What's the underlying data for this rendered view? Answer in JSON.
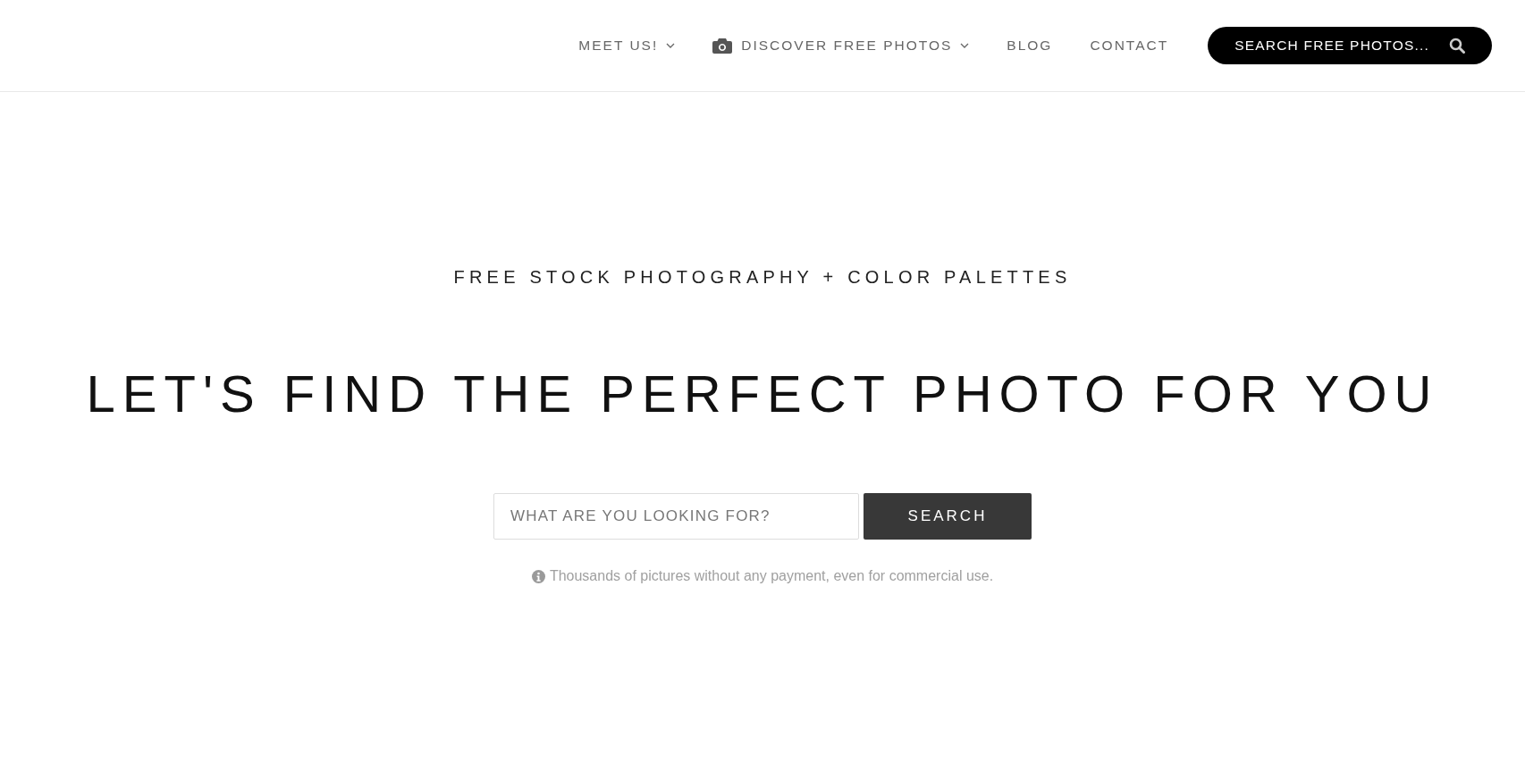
{
  "nav": [
    {
      "label": "MEET US!",
      "dropdown": true
    },
    {
      "label": "DISCOVER FREE PHOTOS",
      "dropdown": true
    },
    {
      "label": "BLOG",
      "dropdown": false
    },
    {
      "label": "CONTACT",
      "dropdown": false
    }
  ],
  "nav_search": {
    "label": "SEARCH FREE PHOTOS..."
  },
  "hero": {
    "tagline": "FREE STOCK PHOTOGRAPHY + COLOR PALETTES",
    "headline": "LET'S FIND THE PERFECT PHOTO FOR YOU"
  },
  "search": {
    "placeholder": "WHAT ARE YOU LOOKING FOR?",
    "button": "SEARCH"
  },
  "note": "Thousands of pictures without any payment, even for commercial use."
}
